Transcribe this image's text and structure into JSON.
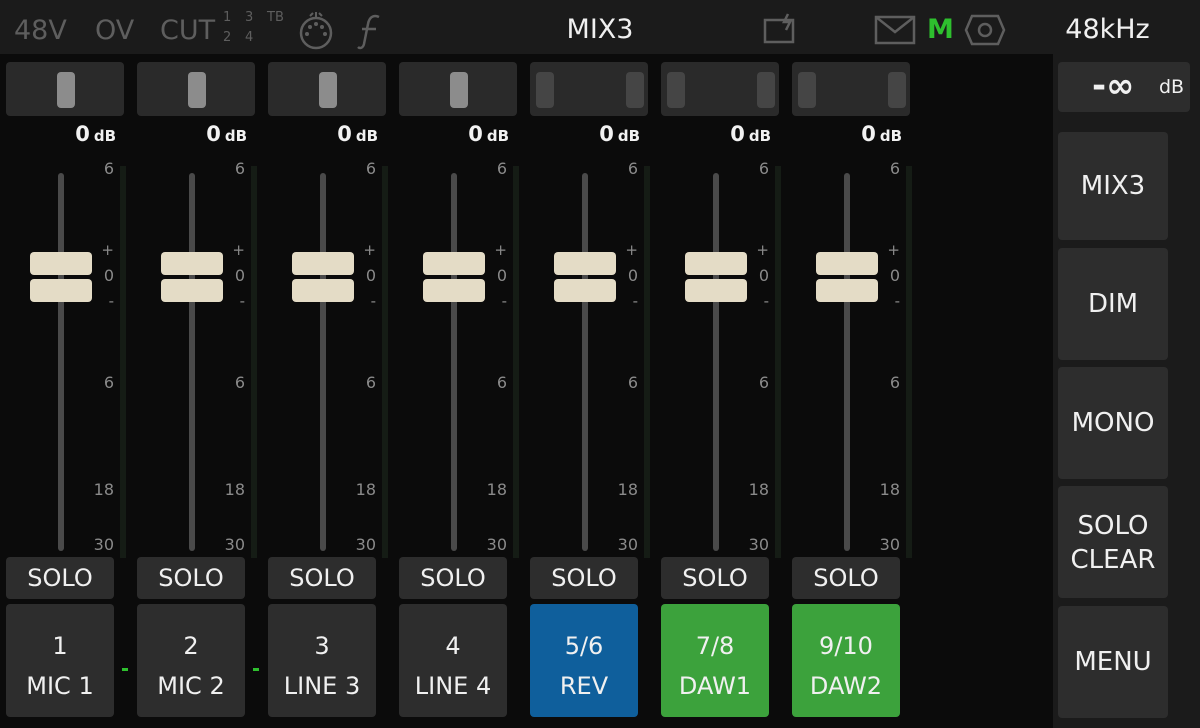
{
  "topbar": {
    "phantom": "48V",
    "overload": "OV",
    "cut": "CUT",
    "cut_nums": [
      "1",
      "3",
      "TB",
      "2",
      "4"
    ],
    "title": "MIX3",
    "m_indicator": "M",
    "sample_rate": "48kHz",
    "icons": [
      "midi-icon",
      "script-f-icon",
      "pc-connection-icon",
      "mail-icon",
      "gear-icon"
    ]
  },
  "scale": {
    "top": "6",
    "plus": "+",
    "zero": "0",
    "minus": "-",
    "six": "6",
    "eighteen": "18",
    "thirty": "30"
  },
  "channels": [
    {
      "number": "1",
      "label": "MIC 1",
      "gain": "0",
      "unit": "dB",
      "solo": "SOLO",
      "color": "#2d2d2d",
      "pan": "mono-center",
      "meter_signal": true
    },
    {
      "number": "2",
      "label": "MIC 2",
      "gain": "0",
      "unit": "dB",
      "solo": "SOLO",
      "color": "#2d2d2d",
      "pan": "mono-center",
      "meter_signal": true
    },
    {
      "number": "3",
      "label": "LINE 3",
      "gain": "0",
      "unit": "dB",
      "solo": "SOLO",
      "color": "#2d2d2d",
      "pan": "mono-center",
      "meter_signal": false
    },
    {
      "number": "4",
      "label": "LINE 4",
      "gain": "0",
      "unit": "dB",
      "solo": "SOLO",
      "color": "#2d2d2d",
      "pan": "mono-center",
      "meter_signal": false
    },
    {
      "number": "5/6",
      "label": "REV",
      "gain": "0",
      "unit": "dB",
      "solo": "SOLO",
      "color": "#0f5f9c",
      "pan": "stereo-wide",
      "meter_signal": false
    },
    {
      "number": "7/8",
      "label": "DAW1",
      "gain": "0",
      "unit": "dB",
      "solo": "SOLO",
      "color": "#3ca23c",
      "pan": "stereo-wide",
      "meter_signal": false
    },
    {
      "number": "9/10",
      "label": "DAW2",
      "gain": "0",
      "unit": "dB",
      "solo": "SOLO",
      "color": "#3ca23c",
      "pan": "stereo-wide",
      "meter_signal": false
    }
  ],
  "right_panel": {
    "level": "-∞",
    "level_unit": "dB",
    "mix": "MIX3",
    "dim": "DIM",
    "mono": "MONO",
    "solo_clear_line1": "SOLO",
    "solo_clear_line2": "CLEAR",
    "menu": "MENU"
  }
}
